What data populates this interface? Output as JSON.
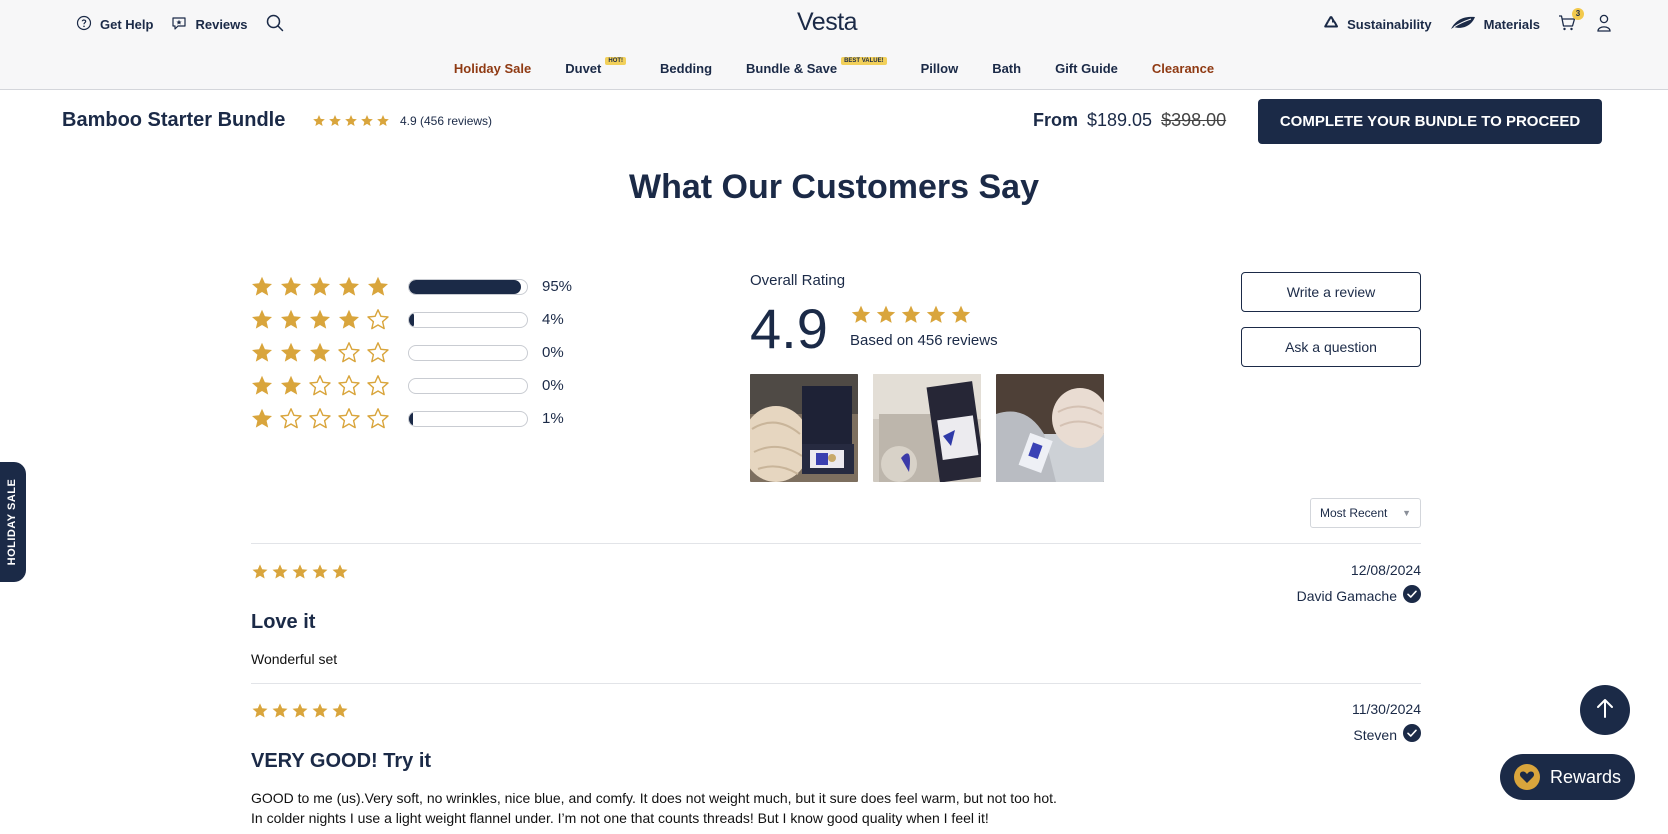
{
  "colors": {
    "navy": "#1b2a47",
    "star_gold": "#d9a53c",
    "sale_brown": "#8f3a13",
    "badge_yellow": "#f2d05a"
  },
  "header": {
    "logo": "Vesta",
    "get_help": "Get Help",
    "reviews": "Reviews",
    "sustainability": "Sustainability",
    "materials": "Materials",
    "cart_count": "3",
    "icons": [
      "help-circle-icon",
      "reviews-icon",
      "search-icon",
      "recycle-icon",
      "leaf-icon",
      "cart-icon",
      "user-icon"
    ]
  },
  "nav": {
    "items": [
      {
        "label": "Holiday Sale",
        "badge": ""
      },
      {
        "label": "Duvet",
        "badge": "HOT!"
      },
      {
        "label": "Bedding",
        "badge": ""
      },
      {
        "label": "Bundle & Save",
        "badge": "BEST VALUE!"
      },
      {
        "label": "Pillow",
        "badge": ""
      },
      {
        "label": "Bath",
        "badge": ""
      },
      {
        "label": "Gift Guide",
        "badge": ""
      },
      {
        "label": "Clearance",
        "badge": ""
      }
    ]
  },
  "product": {
    "title": "Bamboo Starter Bundle",
    "rating_text": "4.9 (456 reviews)",
    "rating_stars": 5,
    "from_label": "From",
    "price": "$189.05",
    "original_price": "$398.00",
    "cta": "COMPLETE YOUR BUNDLE TO PROCEED"
  },
  "reviews_section": {
    "title": "What Our Customers Say",
    "distribution": [
      {
        "stars": 5,
        "fraction": 0.95,
        "pct_label": "95%"
      },
      {
        "stars": 4,
        "fraction": 0.04,
        "pct_label": "4%"
      },
      {
        "stars": 3,
        "fraction": 0.0,
        "pct_label": "0%"
      },
      {
        "stars": 2,
        "fraction": 0.0,
        "pct_label": "0%"
      },
      {
        "stars": 1,
        "fraction": 0.01,
        "pct_label": "1%"
      }
    ],
    "overall_label": "Overall Rating",
    "overall_score": "4.9",
    "overall_stars": 5,
    "based_on": "Based on 456 reviews",
    "write_review": "Write a review",
    "ask_question": "Ask a question",
    "sort_value": "Most Recent",
    "photo_count": 3
  },
  "reviews": [
    {
      "stars": 5,
      "date": "12/08/2024",
      "author": "David Gamache",
      "verified": true,
      "title": "Love it",
      "body": "Wonderful set"
    },
    {
      "stars": 5,
      "date": "11/30/2024",
      "author": "Steven",
      "verified": true,
      "title": "VERY GOOD! Try it",
      "body": "GOOD to me (us).Very soft, no wrinkles, nice blue, and comfy. It does not weight much, but it sure does feel warm, but not too hot. In colder nights I use a light weight flannel under. I’m not one that counts threads! But I know good quality when I feel it!"
    }
  ],
  "floating": {
    "holiday_tab": "HOLIDAY SALE",
    "rewards": "Rewards"
  }
}
